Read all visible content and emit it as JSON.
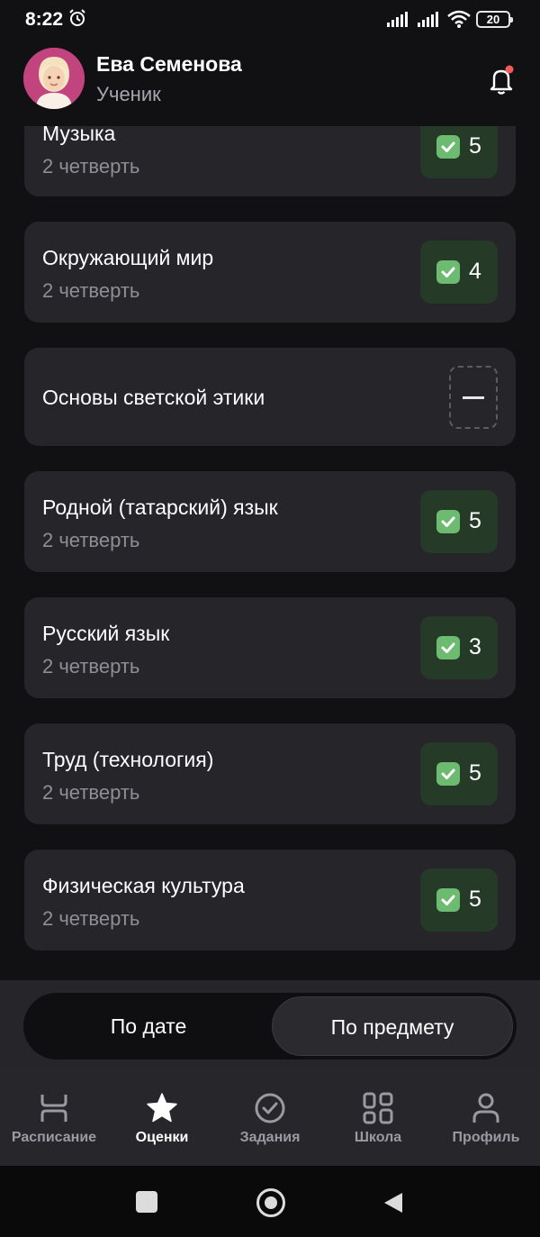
{
  "status_bar": {
    "time": "8:22",
    "battery": "20"
  },
  "header": {
    "user_name": "Ева Семенова",
    "user_role": "Ученик"
  },
  "subjects": [
    {
      "name": "Музыка",
      "term": "2 четверть",
      "grade": "5"
    },
    {
      "name": "Окружающий мир",
      "term": "2 четверть",
      "grade": "4"
    },
    {
      "name": "Основы светской этики",
      "term": "",
      "grade": "—"
    },
    {
      "name": "Родной (татарский) язык",
      "term": "2 четверть",
      "grade": "5"
    },
    {
      "name": "Русский язык",
      "term": "2 четверть",
      "grade": "3"
    },
    {
      "name": "Труд (технология)",
      "term": "2 четверть",
      "grade": "5"
    },
    {
      "name": "Физическая культура",
      "term": "2 четверть",
      "grade": "5"
    }
  ],
  "sort_toggle": {
    "by_date": "По дате",
    "by_subject": "По предмету",
    "selected": "by_subject"
  },
  "bottom_nav": [
    {
      "label": "Расписание",
      "icon": "schedule-icon"
    },
    {
      "label": "Оценки",
      "icon": "star-icon",
      "active": true
    },
    {
      "label": "Задания",
      "icon": "check-circle-icon"
    },
    {
      "label": "Школа",
      "icon": "grid-icon"
    },
    {
      "label": "Профиль",
      "icon": "person-icon"
    }
  ],
  "colors": {
    "card_bg": "#25252a",
    "grade_bg": "#253b27",
    "grade_check": "#6dbb70",
    "notification_dot": "#ef5a5a"
  }
}
